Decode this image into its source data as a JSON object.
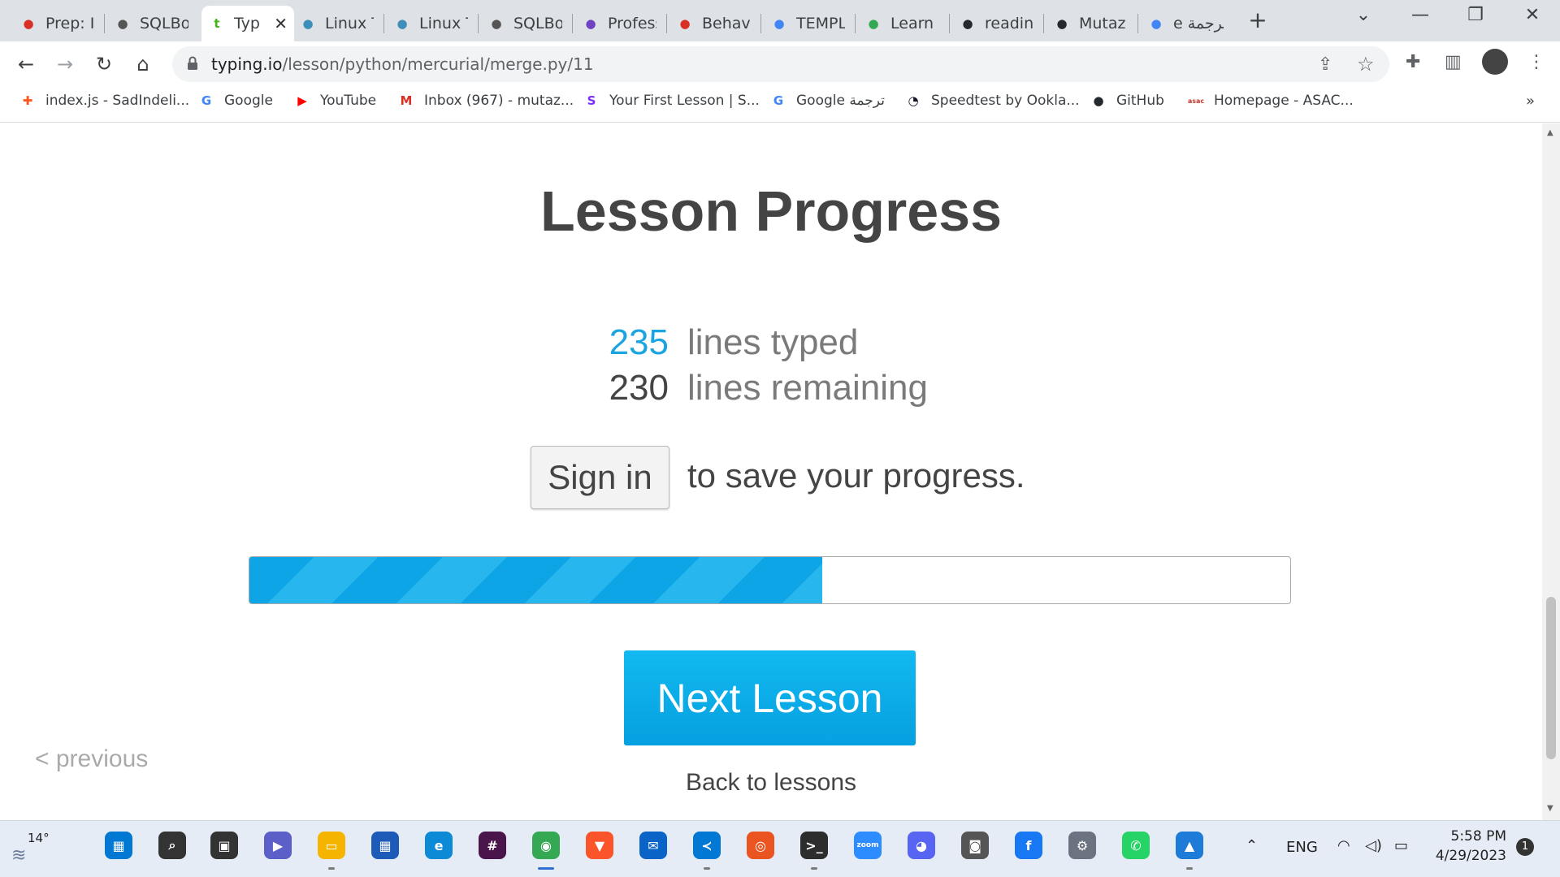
{
  "tabs": [
    {
      "title": "Prep: Ir",
      "icon": "prep-icon",
      "color": "#d93025"
    },
    {
      "title": "SQLBol",
      "icon": "database-icon",
      "color": "#555555"
    },
    {
      "title": "Typ",
      "icon": "typing-icon",
      "color": "#3fb618",
      "active": true
    },
    {
      "title": "Linux T",
      "icon": "linux-globe-icon",
      "color": "#3d8eb9"
    },
    {
      "title": "Linux T",
      "icon": "linux-globe-icon",
      "color": "#3d8eb9"
    },
    {
      "title": "SQLBol",
      "icon": "database-icon",
      "color": "#555555"
    },
    {
      "title": "Profess",
      "icon": "list-icon",
      "color": "#6f42c1"
    },
    {
      "title": "Behavi",
      "icon": "code-shield-icon",
      "color": "#d93025"
    },
    {
      "title": "TEMPL",
      "icon": "docs-icon",
      "color": "#4285f4"
    },
    {
      "title": "Learn (",
      "icon": "learn-icon",
      "color": "#34a853"
    },
    {
      "title": "readinc",
      "icon": "github-icon",
      "color": "#24292e"
    },
    {
      "title": "Mutaz",
      "icon": "github-icon",
      "color": "#24292e"
    },
    {
      "title": "e ترجمة",
      "icon": "translate-icon",
      "color": "#4285f4"
    }
  ],
  "address": {
    "domain": "typing.io",
    "path": "/lesson/python/mercurial/merge.py/11"
  },
  "bookmarks": [
    {
      "label": "index.js - SadIndeli...",
      "icon": "codesandbox-icon",
      "color": "#ff5722",
      "glyph": "✚"
    },
    {
      "label": "Google",
      "icon": "google-icon",
      "color": "#4285f4",
      "glyph": "G"
    },
    {
      "label": "YouTube",
      "icon": "youtube-icon",
      "color": "#ff0000",
      "glyph": "▶"
    },
    {
      "label": "Inbox (967) - mutaz...",
      "icon": "gmail-icon",
      "color": "#d93025",
      "glyph": "M"
    },
    {
      "label": "Your First Lesson | S...",
      "icon": "lesson-icon",
      "color": "#7b2ff7",
      "glyph": "S"
    },
    {
      "label": "Google ترجمة",
      "icon": "translate-icon",
      "color": "#4285f4",
      "glyph": "G"
    },
    {
      "label": "Speedtest by Ookla...",
      "icon": "speedtest-icon",
      "color": "#141526",
      "glyph": "◔"
    },
    {
      "label": "GitHub",
      "icon": "github-icon",
      "color": "#24292e",
      "glyph": "●"
    },
    {
      "label": "Homepage - ASAC...",
      "icon": "asac-icon",
      "color": "#c0392b",
      "glyph": "asac"
    }
  ],
  "page": {
    "title": "Lesson Progress",
    "typed_count": "235",
    "typed_label": "lines typed",
    "remaining_count": "230",
    "remaining_label": "lines remaining",
    "signin_label": "Sign in",
    "save_text": "to save your progress.",
    "progress_fraction": 0.55,
    "next_label": "Next Lesson",
    "back_label": "Back to lessons",
    "previous_label": "< previous"
  },
  "colors": {
    "accent": "#0ea5e6",
    "typed_number": "#1aa4e0"
  },
  "taskbar": {
    "weather": "14°",
    "language": "ENG",
    "time": "5:58 PM",
    "date": "4/29/2023",
    "notifications": "1",
    "apps": [
      {
        "name": "start-icon",
        "color": "#0078d4",
        "glyph": "▦"
      },
      {
        "name": "search-icon",
        "color": "#333333",
        "glyph": "⌕"
      },
      {
        "name": "task-view-icon",
        "color": "#333333",
        "glyph": "▣"
      },
      {
        "name": "teams-chat-icon",
        "color": "#5b5fc7",
        "glyph": "▶"
      },
      {
        "name": "file-explorer-icon",
        "color": "#f4b400",
        "glyph": "▭"
      },
      {
        "name": "ms-store-icon",
        "color": "#1e5bb8",
        "glyph": "▦"
      },
      {
        "name": "edge-icon",
        "color": "#0c8ad6",
        "glyph": "e"
      },
      {
        "name": "slack-icon",
        "color": "#4a154b",
        "glyph": "#"
      },
      {
        "name": "chrome-icon",
        "color": "#34a853",
        "glyph": "◉",
        "active": true
      },
      {
        "name": "brave-icon",
        "color": "#fb542b",
        "glyph": "▼"
      },
      {
        "name": "mail-icon",
        "color": "#0a64c8",
        "glyph": "✉"
      },
      {
        "name": "vscode-icon",
        "color": "#0078d4",
        "glyph": "≺"
      },
      {
        "name": "ubuntu-icon",
        "color": "#e95420",
        "glyph": "◎"
      },
      {
        "name": "terminal-icon",
        "color": "#2d2d2d",
        "glyph": ">_"
      },
      {
        "name": "zoom-icon",
        "color": "#2d8cff",
        "glyph": "zoom"
      },
      {
        "name": "discord-icon",
        "color": "#5865f2",
        "glyph": "◕"
      },
      {
        "name": "camera-icon",
        "color": "#555555",
        "glyph": "◙"
      },
      {
        "name": "facebook-icon",
        "color": "#1877f2",
        "glyph": "f"
      },
      {
        "name": "settings-icon",
        "color": "#6b7280",
        "glyph": "⚙"
      },
      {
        "name": "whatsapp-icon",
        "color": "#25d366",
        "glyph": "✆"
      },
      {
        "name": "photos-icon",
        "color": "#1f7bd8",
        "glyph": "▲"
      }
    ]
  }
}
